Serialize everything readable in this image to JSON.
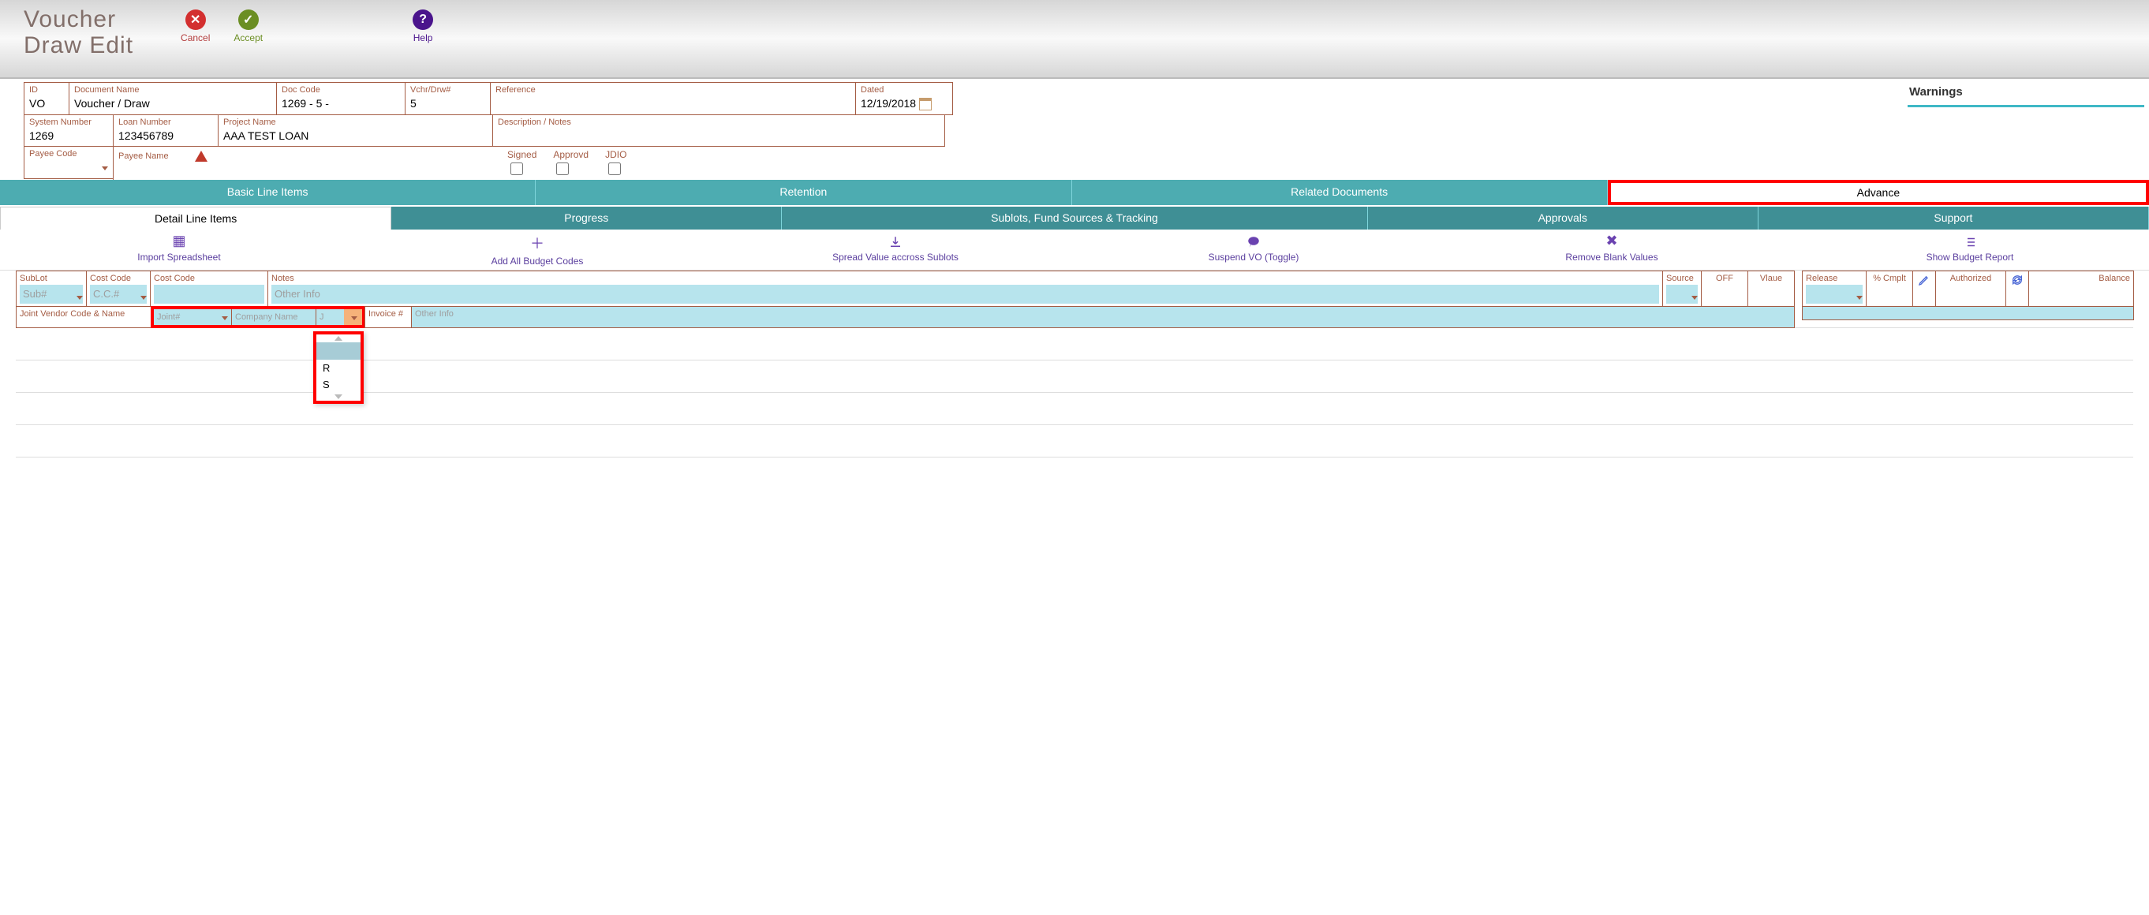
{
  "title_line1": "Voucher",
  "title_line2": "Draw Edit",
  "toolbar": {
    "cancel": "Cancel",
    "accept": "Accept",
    "help": "Help"
  },
  "warnings_title": "Warnings",
  "header": {
    "id_label": "ID",
    "id_value": "VO",
    "docname_label": "Document Name",
    "docname_value": "Voucher / Draw",
    "doccode_label": "Doc Code",
    "doccode_value": "1269 - 5 -",
    "vdrw_label": "Vchr/Drw#",
    "vdrw_value": "5",
    "reference_label": "Reference",
    "reference_value": "",
    "dated_label": "Dated",
    "dated_value": "12/19/2018",
    "sysnum_label": "System Number",
    "sysnum_value": "1269",
    "loannum_label": "Loan Number",
    "loannum_value": "123456789",
    "projname_label": "Project Name",
    "projname_value": "AAA TEST LOAN",
    "desc_label": "Description / Notes",
    "desc_value": "",
    "payeecode_label": "Payee Code",
    "payeename_label": "Payee Name",
    "flags": {
      "signed": "Signed",
      "approvd": "Approvd",
      "jdio": "JDIO"
    }
  },
  "tabs1": {
    "basic": "Basic Line Items",
    "retention": "Retention",
    "related": "Related Documents",
    "advance": "Advance"
  },
  "tabs2": {
    "detail": "Detail Line Items",
    "progress": "Progress",
    "sublots": "Sublots, Fund Sources & Tracking",
    "approvals": "Approvals",
    "support": "Support"
  },
  "tbar": {
    "import": "Import Spreadsheet",
    "addall": "Add All Budget Codes",
    "spread": "Spread Value accross Sublots",
    "suspend": "Suspend VO (Toggle)",
    "remove": "Remove Blank Values",
    "budget": "Show Budget Report"
  },
  "gridhdr": {
    "sublot": "SubLot",
    "sublot_ph": "Sub#",
    "costcode1": "Cost Code",
    "costcode1_ph": "C.C.#",
    "costcode2": "Cost Code",
    "notes": "Notes",
    "notes_ph": "Other Info",
    "source": "Source",
    "off": "OFF",
    "vlaue": "Vlaue",
    "release": "Release",
    "cmplt": "% Cmplt",
    "authorized": "Authorized",
    "balance": "Balance",
    "jointvendor": "Joint Vendor Code & Name",
    "joint_ph": "Joint#",
    "company_ph": "Company Name",
    "j_ph": "J",
    "invoice": "Invoice #",
    "invoice_ph": "Other Info"
  },
  "dropdown_options": [
    "R",
    "S"
  ]
}
